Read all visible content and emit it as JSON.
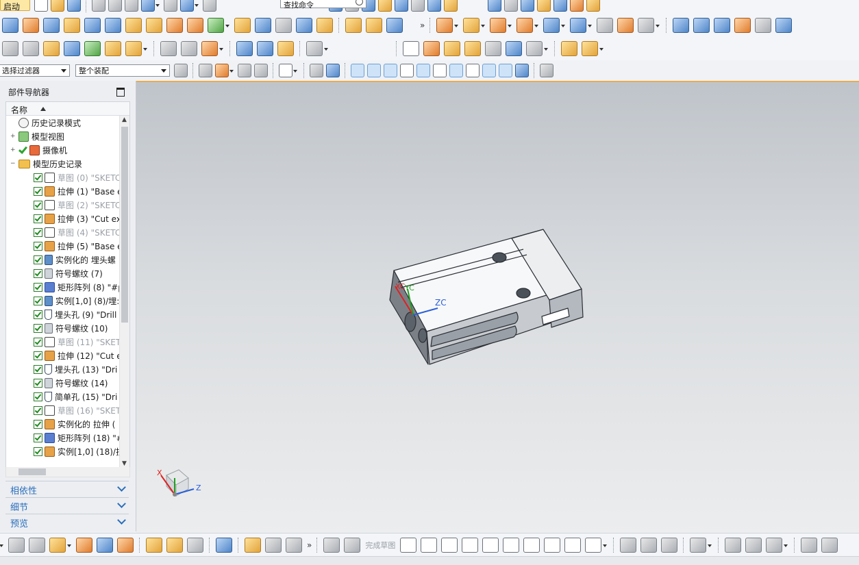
{
  "toolbar": {
    "start_label": "启动",
    "command_search_value": "查找命令",
    "selection_filter_value": "选择过滤器",
    "assembly_scope_value": "整个装配",
    "finish_sketch_label": "完成草图"
  },
  "navigator": {
    "title": "部件导航器",
    "column_name": "名称",
    "top_nodes": [
      {
        "label": "历史记录模式"
      },
      {
        "label": "模型视图"
      },
      {
        "label": "摄像机"
      },
      {
        "label": "模型历史记录"
      }
    ],
    "features": [
      {
        "label": "草图 (0) \"SKETC",
        "icon": "sketch",
        "suppressed": true
      },
      {
        "label": "拉伸 (1) \"Base e",
        "icon": "extr",
        "suppressed": false
      },
      {
        "label": "草图 (2) \"SKETC",
        "icon": "sketch",
        "suppressed": true
      },
      {
        "label": "拉伸 (3) \"Cut ex",
        "icon": "extr",
        "suppressed": false
      },
      {
        "label": "草图 (4) \"SKETC",
        "icon": "sketch",
        "suppressed": true
      },
      {
        "label": "拉伸 (5) \"Base e",
        "icon": "extr",
        "suppressed": false
      },
      {
        "label": "实例化的 埋头螺",
        "icon": "inst",
        "suppressed": false
      },
      {
        "label": "符号螺纹 (7)",
        "icon": "thread",
        "suppressed": false
      },
      {
        "label": "矩形阵列 (8) \"#p",
        "icon": "pat",
        "suppressed": false
      },
      {
        "label": "实例[1,0] (8)/埋:",
        "icon": "inst",
        "suppressed": false
      },
      {
        "label": "埋头孔 (9) \"Drill",
        "icon": "hole",
        "suppressed": false
      },
      {
        "label": "符号螺纹 (10)",
        "icon": "thread",
        "suppressed": false
      },
      {
        "label": "草图 (11) \"SKET",
        "icon": "sketch",
        "suppressed": true
      },
      {
        "label": "拉伸 (12) \"Cut e",
        "icon": "extr",
        "suppressed": false
      },
      {
        "label": "埋头孔 (13) \"Dri",
        "icon": "hole",
        "suppressed": false
      },
      {
        "label": "符号螺纹 (14)",
        "icon": "thread",
        "suppressed": false
      },
      {
        "label": "简单孔 (15) \"Dri",
        "icon": "hole",
        "suppressed": false
      },
      {
        "label": "草图 (16) \"SKET",
        "icon": "sketch",
        "suppressed": true
      },
      {
        "label": "实例化的 拉伸 (",
        "icon": "extr",
        "suppressed": false
      },
      {
        "label": "矩形阵列 (18) \"#",
        "icon": "pat",
        "suppressed": false
      },
      {
        "label": "实例[1,0] (18)/拉",
        "icon": "extr",
        "suppressed": false
      }
    ],
    "panels": [
      {
        "label": "相依性"
      },
      {
        "label": "细节"
      },
      {
        "label": "预览"
      }
    ]
  },
  "viewport": {
    "csys_labels": {
      "xc": "XC",
      "yc": "YC",
      "zc": "ZC"
    },
    "triad_labels": {
      "x": "X",
      "z": "Z"
    },
    "colors": {
      "x_axis": "#e02020",
      "y_axis": "#20a020",
      "z_axis": "#2a5fd8",
      "accent": "#e5ac55"
    }
  }
}
